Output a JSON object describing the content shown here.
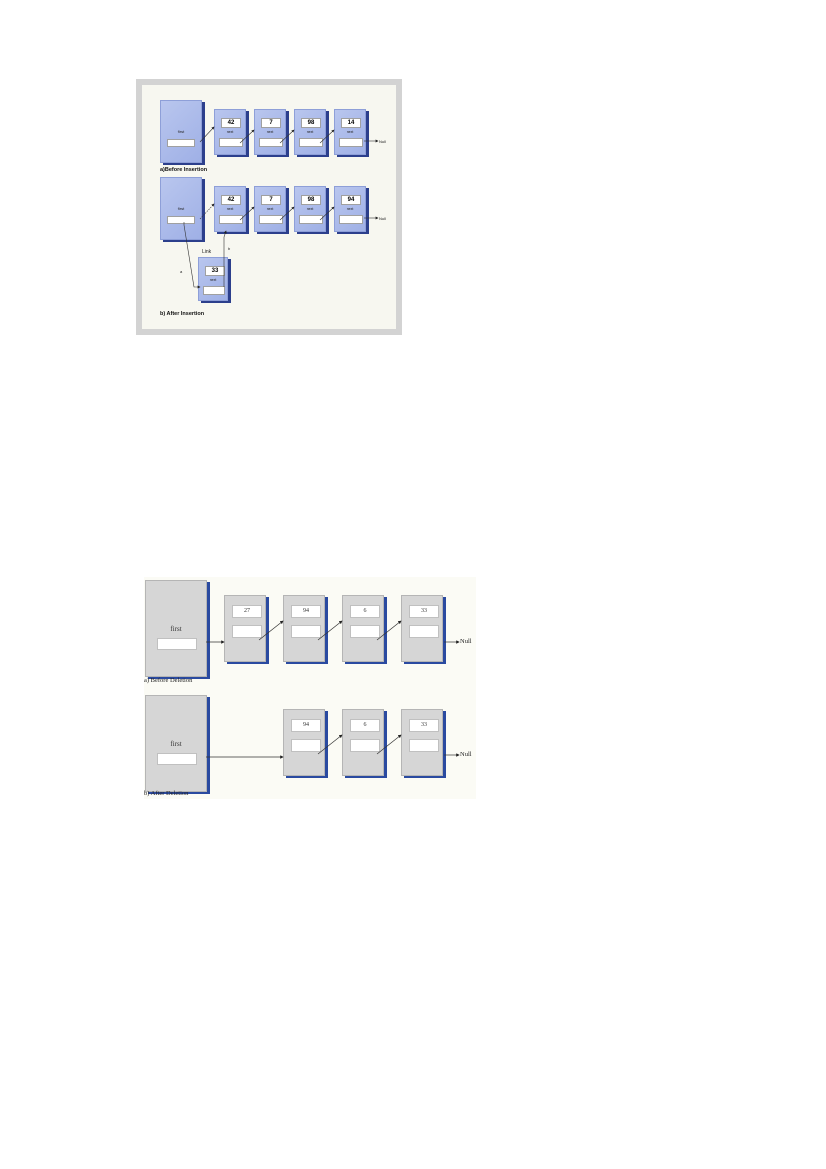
{
  "insertion_figure": {
    "first_label": "first",
    "before": {
      "caption": "a)Before Insertion",
      "nodes": [
        {
          "value": "42",
          "label": "next"
        },
        {
          "value": "7",
          "label": "next"
        },
        {
          "value": "98",
          "label": "next"
        },
        {
          "value": "14",
          "label": "next"
        }
      ],
      "null_label": "Null"
    },
    "after": {
      "caption": "b) After Insertion",
      "nodes": [
        {
          "value": "42",
          "label": "next"
        },
        {
          "value": "7",
          "label": "next"
        },
        {
          "value": "98",
          "label": "next"
        },
        {
          "value": "94",
          "label": "next"
        }
      ],
      "null_label": "Null",
      "new_node": {
        "title": "Link",
        "value": "33",
        "label": "next"
      },
      "step_labels": [
        "a",
        "b"
      ]
    }
  },
  "deletion_figure": {
    "first_label": "first",
    "before": {
      "caption": "a) Before Deletion",
      "nodes": [
        "27",
        "94",
        "6",
        "33"
      ],
      "null_label": "Null"
    },
    "after": {
      "caption": "b) After Deletion",
      "nodes": [
        "94",
        "6",
        "33"
      ],
      "null_label": "Null"
    }
  },
  "colors": {
    "node_blue": "#a9b8ea",
    "node_shadow_blue": "#2c3f8c",
    "node_grey": "#d6d6d6",
    "node_shadow_grey": "#2a4aa0"
  }
}
